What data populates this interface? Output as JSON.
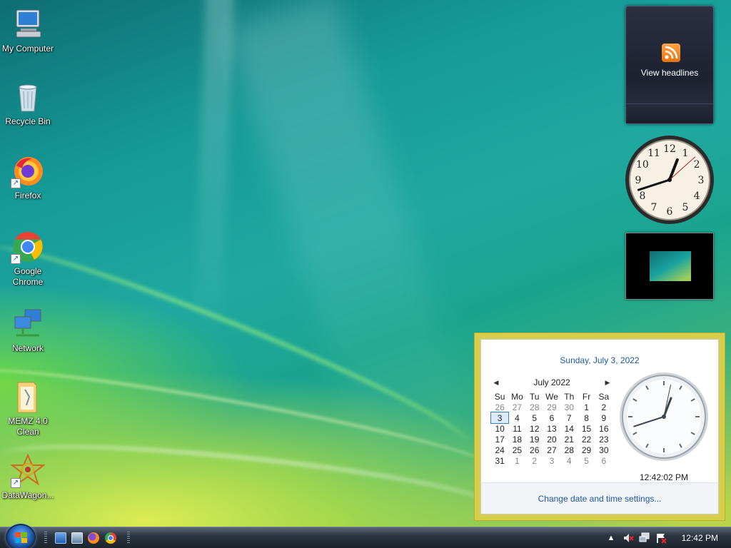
{
  "desktop": {
    "icons": [
      {
        "label": "My Computer"
      },
      {
        "label": "Recycle Bin"
      },
      {
        "label": "Firefox"
      },
      {
        "label": "Google Chrome"
      },
      {
        "label": "Network"
      },
      {
        "label": "MEMZ 4.0 Clean"
      },
      {
        "label": "DataWagon..."
      }
    ]
  },
  "gadgets": {
    "feed_label": "View headlines",
    "clock_hands": {
      "hour": 12,
      "minute": 42,
      "second": 8
    }
  },
  "calendar": {
    "full_date": "Sunday, July 3, 2022",
    "month_label": "July 2022",
    "weekdays": [
      "Su",
      "Mo",
      "Tu",
      "We",
      "Th",
      "Fr",
      "Sa"
    ],
    "weeks": [
      [
        "26",
        "27",
        "28",
        "29",
        "30",
        "1",
        "2"
      ],
      [
        "3",
        "4",
        "5",
        "6",
        "7",
        "8",
        "9"
      ],
      [
        "10",
        "11",
        "12",
        "13",
        "14",
        "15",
        "16"
      ],
      [
        "17",
        "18",
        "19",
        "20",
        "21",
        "22",
        "23"
      ],
      [
        "24",
        "25",
        "26",
        "27",
        "28",
        "29",
        "30"
      ],
      [
        "31",
        "1",
        "2",
        "3",
        "4",
        "5",
        "6"
      ]
    ],
    "clock_time": "12:42:02 PM",
    "clock_hands": {
      "hour": 12,
      "minute": 42,
      "second": 2
    },
    "settings_link": "Change date and time settings..."
  },
  "taskbar": {
    "time": "12:42 PM",
    "tray_icons": [
      "show-hidden-icons-arrow",
      "volume-muted-icon",
      "network-icon",
      "action-center-icon"
    ]
  },
  "colors": {
    "flyout_border": "#d7cf49",
    "link_blue": "#1e5aa8"
  }
}
